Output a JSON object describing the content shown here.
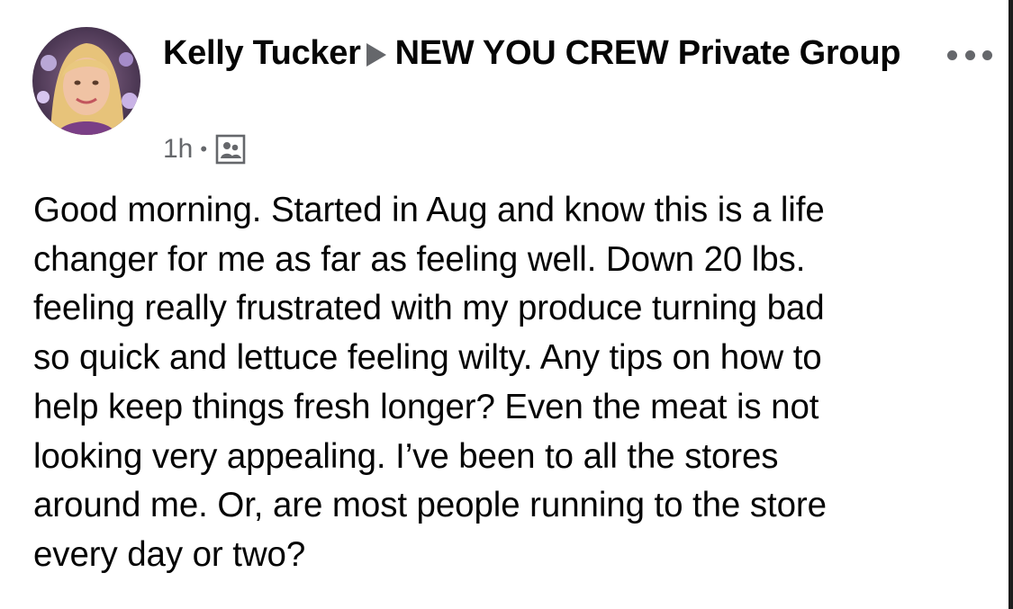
{
  "post": {
    "author": "Kelly Tucker",
    "group": "NEW YOU CREW Private Group",
    "timestamp": "1h",
    "visibility_icon": "group-members-icon",
    "more_options_icon": "more-options-icon",
    "body_lines": [
      "Good morning. Started in Aug and know this is a life",
      "changer for me as far as feeling well. Down 20 lbs.",
      "feeling really frustrated with my produce turning bad",
      "so quick and lettuce feeling wilty. Any tips on how to",
      "help keep things fresh longer? Even the meat is not",
      "looking very appealing. I’ve been to all the stores",
      "around me. Or, are most people running to the store",
      "every day or two?"
    ]
  },
  "colors": {
    "text_primary": "#050505",
    "text_secondary": "#65676b",
    "background": "#ffffff"
  }
}
